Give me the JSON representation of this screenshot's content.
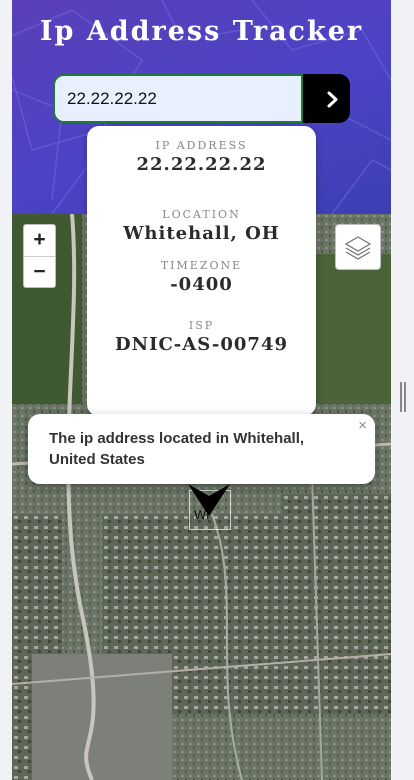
{
  "header": {
    "title": "Ip Address Tracker",
    "search": {
      "value": "22.22.22.22"
    },
    "colors": {
      "background": "#4b43c5",
      "button": "#000000",
      "input_border": "#1f7a3a"
    }
  },
  "info_card": {
    "ip_label": "IP ADDRESS",
    "ip_value": "22.22.22.22",
    "location_label": "LOCATION",
    "location_value": "Whitehall, OH",
    "timezone_label": "TIMEZONE",
    "timezone_value": "-0400",
    "isp_label": "ISP",
    "isp_value": "DNIC-AS-00749"
  },
  "map": {
    "zoom_in_label": "+",
    "zoom_out_label": "−",
    "popup_text": "The ip address located in Whitehall, United States",
    "popup_close": "×",
    "marker_label": "Wi"
  },
  "icons": {
    "submit": "chevron-right-icon",
    "layers": "layers-icon",
    "marker": "map-marker-icon",
    "close": "close-icon"
  }
}
